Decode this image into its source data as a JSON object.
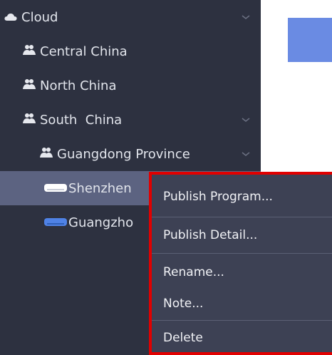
{
  "sidebar": {
    "items": [
      {
        "label": "Cloud",
        "icon": "cloud-icon",
        "expanded": true
      },
      {
        "label": "Central China",
        "icon": "group-icon"
      },
      {
        "label": "North China",
        "icon": "group-icon"
      },
      {
        "label": "South  China",
        "icon": "group-icon",
        "expanded": true
      },
      {
        "label": "Guangdong Province",
        "icon": "group-icon",
        "expanded": true
      },
      {
        "label": "Shenzhen",
        "icon": "device-icon-white",
        "selected": true
      },
      {
        "label": "Guangzho",
        "icon": "device-icon-blue"
      }
    ]
  },
  "context_menu": {
    "items": [
      {
        "label": "Publish Program..."
      },
      {
        "label": "Publish Detail..."
      },
      {
        "label": "Rename..."
      },
      {
        "label": "Note..."
      },
      {
        "label": "Delete"
      }
    ]
  },
  "colors": {
    "sidebar_bg": "#2d3140",
    "selected_bg": "#5c6381",
    "menu_bg": "#3d4154",
    "highlight_border": "#e10000",
    "accent_blue": "#6a8be3"
  }
}
